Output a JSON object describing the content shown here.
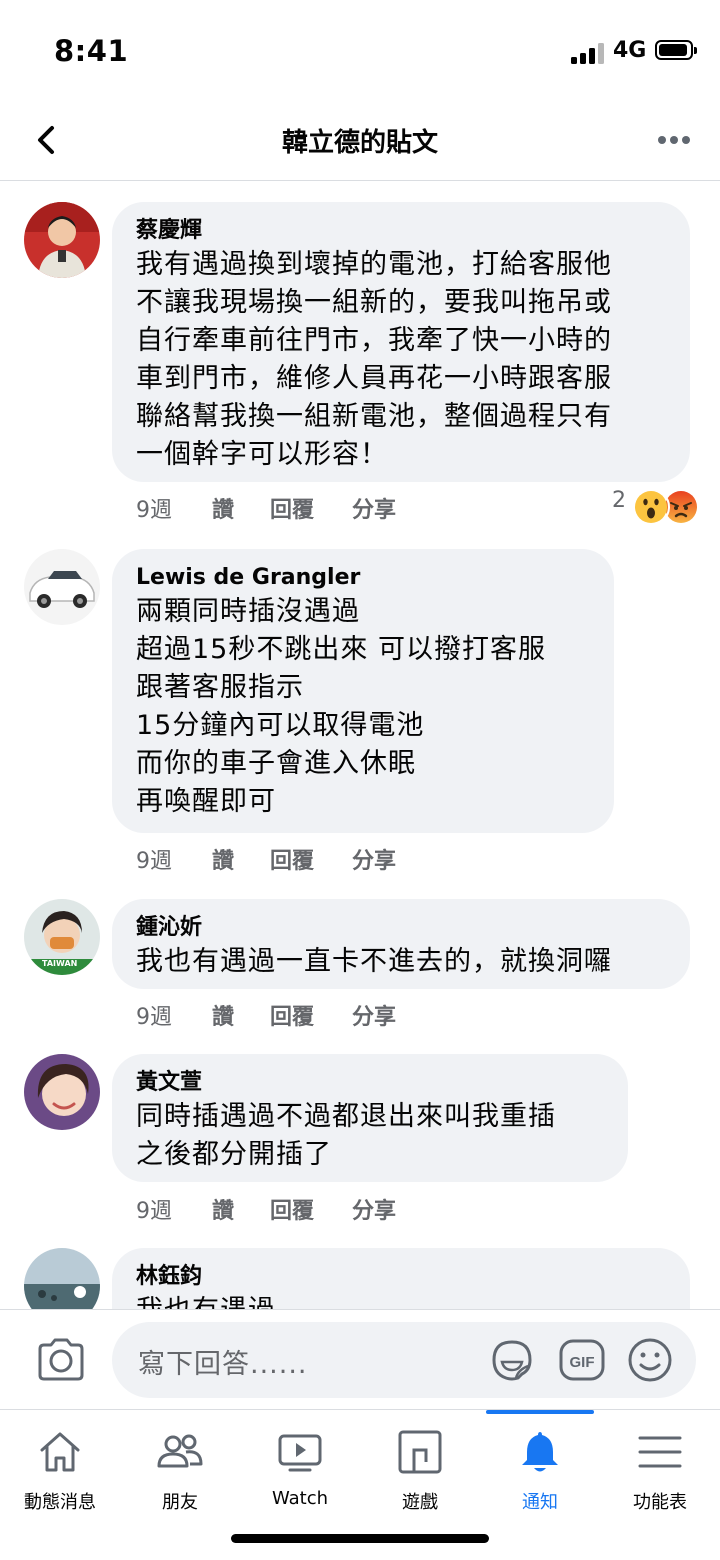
{
  "status": {
    "time": "8:41",
    "network": "4G"
  },
  "header": {
    "title": "韓立德的貼文"
  },
  "comments": [
    {
      "author": "蔡慶輝",
      "lines": [
        "我有遇過換到壞掉的電池，打給客服他",
        "不讓我現場換一組新的，要我叫拖吊或",
        "自行牽車前往門市，我牽了快一小時的",
        "車到門市，維修人員再花一小時跟客服",
        "聯絡幫我換一組新電池，整個過程只有",
        "一個幹字可以形容！"
      ],
      "time": "9週",
      "like": "讚",
      "reply": "回覆",
      "share": "分享",
      "reaction_count": "2"
    },
    {
      "author": "Lewis de Grangler",
      "lines": [
        "兩顆同時插沒遇過",
        "超過15秒不跳出來 可以撥打客服",
        "跟著客服指示",
        "15分鐘內可以取得電池",
        "而你的車子會進入休眠",
        "再喚醒即可"
      ],
      "time": "9週",
      "like": "讚",
      "reply": "回覆",
      "share": "分享"
    },
    {
      "author": "鍾沁妡",
      "lines": [
        "我也有遇過一直卡不進去的，就換洞囉"
      ],
      "time": "9週",
      "like": "讚",
      "reply": "回覆",
      "share": "分享",
      "avatar_badge": "TAIWAN"
    },
    {
      "author": "黃文萱",
      "lines": [
        "同時插遇過不過都退出來叫我重插",
        "之後都分開插了"
      ],
      "time": "9週",
      "like": "讚",
      "reply": "回覆",
      "share": "分享"
    },
    {
      "author": "林鈺鈞",
      "lines": [
        "我也有遇過"
      ]
    }
  ],
  "compose": {
    "placeholder": "寫下回答......"
  },
  "tabs": [
    {
      "label": "動態消息",
      "icon": "home-icon"
    },
    {
      "label": "朋友",
      "icon": "friends-icon"
    },
    {
      "label": "Watch",
      "icon": "watch-icon"
    },
    {
      "label": "遊戲",
      "icon": "gaming-icon"
    },
    {
      "label": "通知",
      "icon": "bell-icon",
      "active": true
    },
    {
      "label": "功能表",
      "icon": "menu-icon"
    }
  ],
  "colors": {
    "accent": "#1877f2",
    "bubble": "#f0f2f5",
    "secondary_text": "#65676b"
  }
}
